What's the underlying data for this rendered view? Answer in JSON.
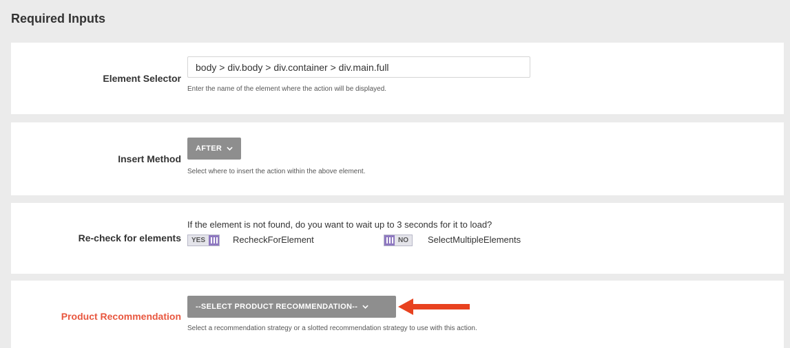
{
  "header": {
    "title": "Required Inputs"
  },
  "element_selector": {
    "label": "Element Selector",
    "value": "body > div.body > div.container > div.main.full",
    "help": "Enter the name of the element where the action will be displayed."
  },
  "insert_method": {
    "label": "Insert Method",
    "button": "AFTER",
    "help": "Select where to insert the action within the above element."
  },
  "recheck": {
    "label": "Re-check for elements",
    "question": "If the element is not found, do you want to wait up to 3 seconds for it to load?",
    "toggle1": {
      "text": "YES",
      "name": "RecheckForElement"
    },
    "toggle2": {
      "text": "NO",
      "name": "SelectMultipleElements"
    }
  },
  "product_recommendation": {
    "label": "Product Recommendation",
    "button": "--SELECT PRODUCT RECOMMENDATION--",
    "help": "Select a recommendation strategy or a slotted recommendation strategy to use with this action."
  },
  "colors": {
    "background": "#ebebeb",
    "button": "#8e8e8e",
    "toggle_accent": "#8e78c0",
    "required_label": "#e8573f",
    "arrow": "#e8421f"
  }
}
